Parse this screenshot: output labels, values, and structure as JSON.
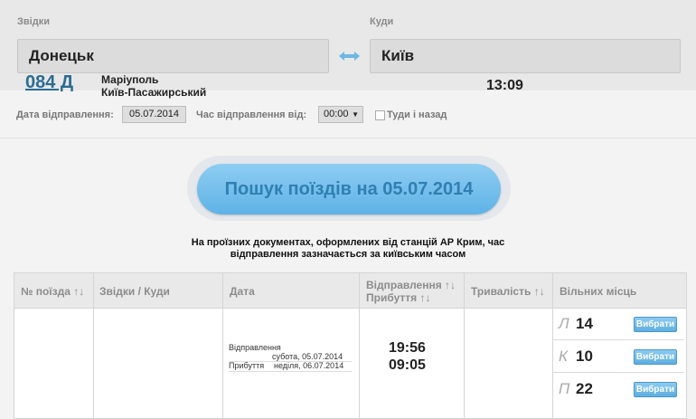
{
  "route": {
    "from_label": "Звідки",
    "from_value": "Донецьк",
    "to_label": "Куди",
    "to_value": "Київ"
  },
  "options": {
    "date_label": "Дата відправлення:",
    "date_value": "05.07.2014",
    "time_label": "Час відправлення від:",
    "time_value": "00:00",
    "roundtrip_label": "Туди і назад",
    "roundtrip_checked": false
  },
  "search": {
    "button_label": "Пошук поїздів на 05.07.2014"
  },
  "notice": {
    "line1": "На проїзних документах, оформлених від станцій АР Крим, час",
    "line2": "відправлення зазначається за київським часом"
  },
  "table": {
    "headers": {
      "train": "№ поїзда ↑↓",
      "route": "Звідки / Куди",
      "date": "Дата",
      "times_line1": "Відправлення ↑↓",
      "times_line2": "Прибуття ↑↓",
      "duration": "Тривалість ↑↓",
      "seats": "Вільних місць"
    },
    "rows": [
      {
        "train": "084 Д",
        "from": "Маріуполь",
        "to": "Київ-Пасажирський",
        "dep_label": "Відправлення",
        "dep_date": "субота, 05.07.2014",
        "arr_label": "Прибуття",
        "arr_date": "неділя, 06.07.2014",
        "dep_time": "19:56",
        "arr_time": "09:05",
        "duration": "13:09",
        "seats": [
          {
            "type": "Л",
            "count": "14",
            "button": "Вибрати"
          },
          {
            "type": "К",
            "count": "10",
            "button": "Вибрати"
          },
          {
            "type": "П",
            "count": "22",
            "button": "Вибрати"
          }
        ]
      }
    ]
  },
  "colors": {
    "accent": "#5fb2e6",
    "link": "#2a6c94"
  }
}
